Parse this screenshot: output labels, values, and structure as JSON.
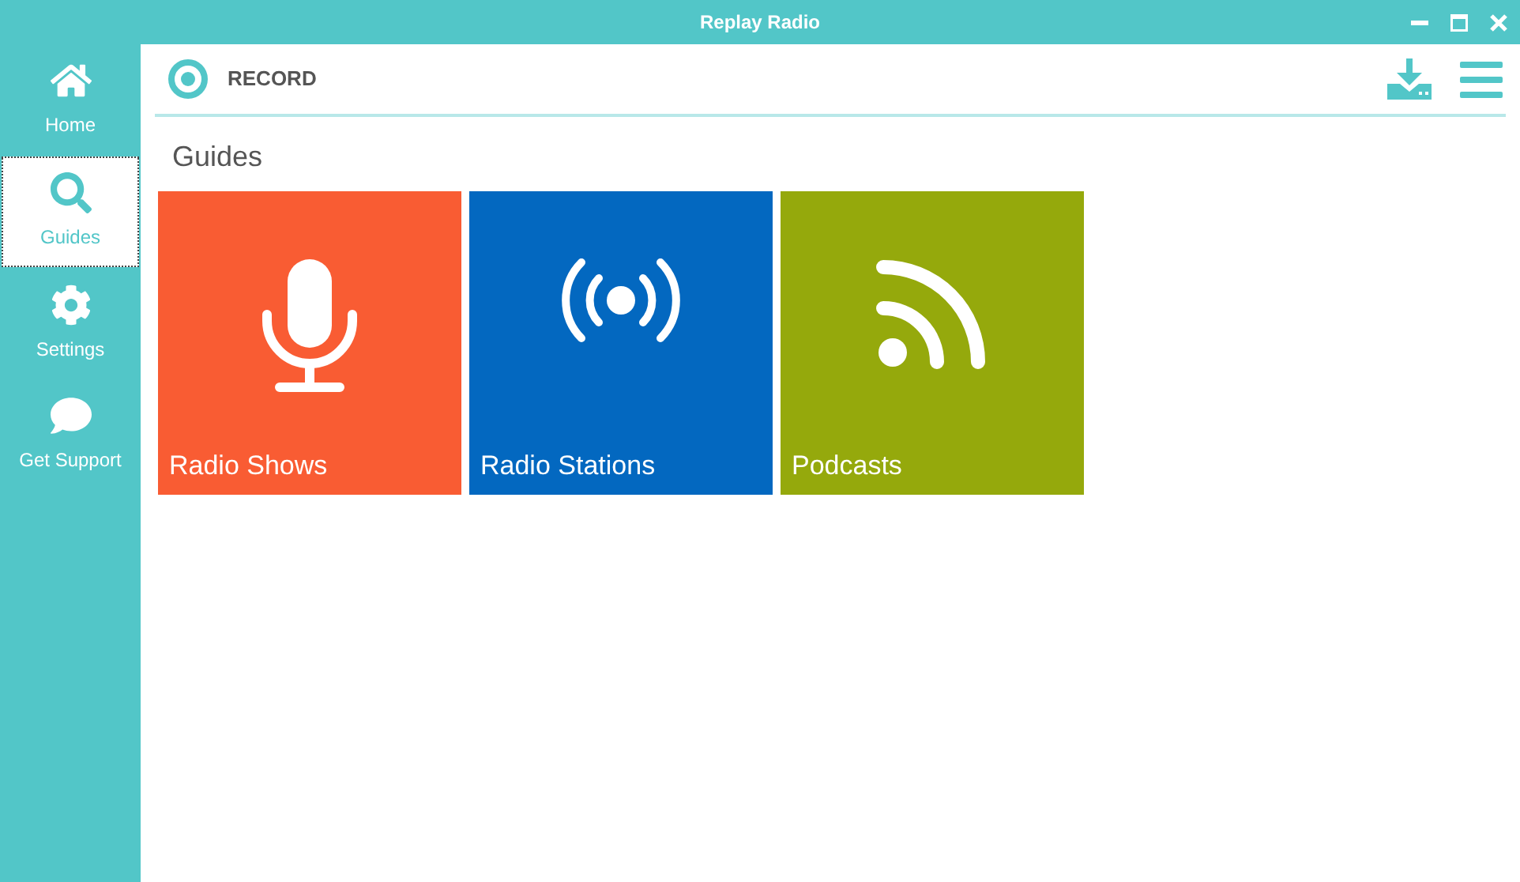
{
  "window": {
    "title": "Replay Radio"
  },
  "sidebar": {
    "items": [
      {
        "label": "Home",
        "kind": "home",
        "selected": false
      },
      {
        "label": "Guides",
        "kind": "guides",
        "selected": true
      },
      {
        "label": "Settings",
        "kind": "settings",
        "selected": false
      },
      {
        "label": "Get Support",
        "kind": "support",
        "selected": false
      }
    ]
  },
  "header": {
    "record_label": "RECORD"
  },
  "section": {
    "title": "Guides"
  },
  "tiles": [
    {
      "label": "Radio Shows",
      "kind": "microphone",
      "color": "#f95c33"
    },
    {
      "label": "Radio Stations",
      "kind": "broadcast",
      "color": "#0368c0"
    },
    {
      "label": "Podcasts",
      "kind": "rss",
      "color": "#95a90c"
    }
  ]
}
